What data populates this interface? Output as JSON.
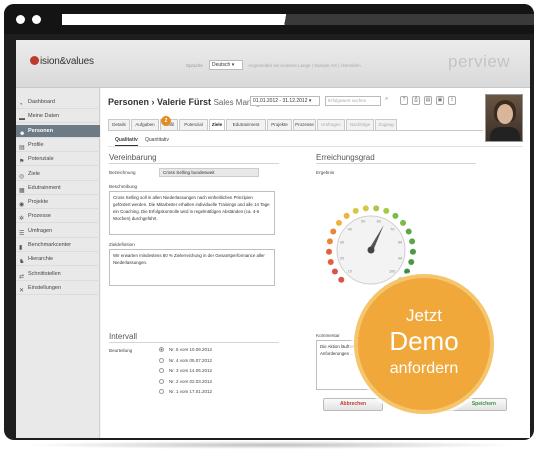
{
  "header": {
    "logo_text": "ision&values",
    "lang_label": "Sprache",
    "lang_value": "Deutsch",
    "user_text": "Angemeldet als Andreas Lange | Sample AG | Abmelden",
    "brand": "perview"
  },
  "sidebar": {
    "items": [
      {
        "label": "Dashboard",
        "icon": "dashboard-icon"
      },
      {
        "label": "Meine Daten",
        "icon": "folder-icon"
      },
      {
        "label": "Personen",
        "icon": "people-icon"
      },
      {
        "label": "Profile",
        "icon": "profile-icon"
      },
      {
        "label": "Potenziale",
        "icon": "flag-icon"
      },
      {
        "label": "Ziele",
        "icon": "target-icon"
      },
      {
        "label": "Edutrainment",
        "icon": "calendar-icon"
      },
      {
        "label": "Projekte",
        "icon": "project-icon"
      },
      {
        "label": "Prozesse",
        "icon": "gear-icon"
      },
      {
        "label": "Umfragen",
        "icon": "survey-icon"
      },
      {
        "label": "Benchmarkcenter",
        "icon": "bar-chart-icon"
      },
      {
        "label": "Hierarchie",
        "icon": "hierarchy-icon"
      },
      {
        "label": "Schnittstellen",
        "icon": "sync-icon"
      },
      {
        "label": "Einstellungen",
        "icon": "tools-icon"
      }
    ],
    "active_index": 2
  },
  "page": {
    "breadcrumb": "Personen › Valerie Fürst",
    "role": "Sales Manager",
    "date_range": "01.01.2012 - 31.12.2012",
    "search_placeholder": "Erfolgswert suchen"
  },
  "tabs": [
    {
      "label": "Details"
    },
    {
      "label": "Aufgaben"
    },
    {
      "label": "Profil"
    },
    {
      "label": "Potenzial"
    },
    {
      "label": "Ziele"
    },
    {
      "label": "Edutrainment"
    },
    {
      "label": "Projekte"
    },
    {
      "label": "Prozesse"
    },
    {
      "label": "Umfragen"
    },
    {
      "label": "Nachfolge"
    },
    {
      "label": "Zugang"
    }
  ],
  "tab_badge": "2",
  "subtabs": [
    "Qualitativ",
    "Quantitativ"
  ],
  "vereinbarung": {
    "heading": "Vereinbarung",
    "bezeichnung_label": "Bezeichnung",
    "bezeichnung_value": "Cross Selling bundesweit",
    "beschreibung_label": "Beschreibung",
    "beschreibung_value": "Cross Selling soll in allen Niederlassungen nach einheitlichen Prinzipien gefördert werden. Die Mitarbeiter erhalten individuelle Trainings und alle 14 Tage ein Coaching. Die Erfolgskontrolle wird in regelmäßigen Abständen (ca. 4-6 Wochen) durchgeführt.",
    "zieldefinition_label": "Zieldefinition",
    "zieldefinition_value": "Wir erwarten mindestens 80 % Zielerreichung in der Gesamtperformance aller Niederlassungen."
  },
  "intervall": {
    "heading": "Intervall",
    "beurteilung_label": "Beurteilung",
    "options": [
      "Nr. 5 vom 10.09.2012",
      "Nr. 4 vom 05.07.2012",
      "Nr. 3 vom 14.05.2012",
      "Nr. 2 vom 02.03.2012",
      "Nr. 1 vom 17.01.2012"
    ],
    "selected_index": 0
  },
  "erreichung": {
    "heading": "Erreichungsgrad",
    "ergebnis_label": "Ergebnis",
    "gauge_ticks": [
      "10",
      "20",
      "30",
      "40",
      "50",
      "60",
      "70",
      "80",
      "90",
      "100"
    ],
    "gauge_fraction": 0.6,
    "kommentar_label": "Kommentar",
    "kommentar_value": "Die Aktion läuft mere… kann ggf. sogar in … den Anforderungen …"
  },
  "buttons": {
    "abbrechen": "Abbrechen",
    "speichern": "Speichern"
  },
  "promo": {
    "line1": "Jetzt",
    "line2": "Demo",
    "line3": "anfordern"
  },
  "colors": {
    "accent_orange": "#f0a83a",
    "sidebar_active": "#6d7b86",
    "cancel_red": "#c0392b",
    "save_green": "#3e8e41"
  }
}
